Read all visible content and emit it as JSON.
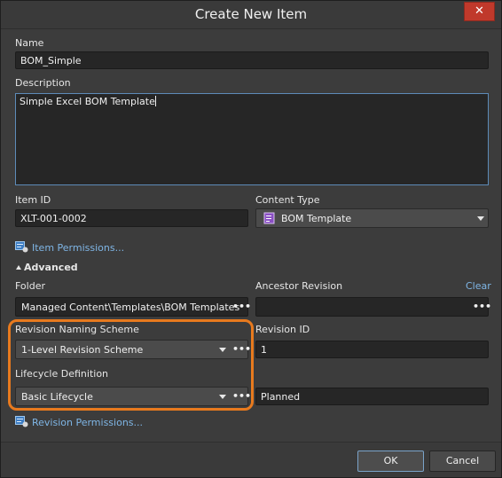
{
  "window": {
    "title": "Create New Item",
    "close_label": "✕"
  },
  "name": {
    "label": "Name",
    "value": "BOM_Simple"
  },
  "description": {
    "label": "Description",
    "value": "Simple Excel BOM Template"
  },
  "item_id": {
    "label": "Item ID",
    "value": "XLT-001-0002"
  },
  "content_type": {
    "label": "Content Type",
    "value": "BOM Template",
    "icon": "bom-template-icon"
  },
  "item_permissions": {
    "label": "Item Permissions..."
  },
  "advanced": {
    "label": "Advanced",
    "expanded": true
  },
  "folder": {
    "label": "Folder",
    "value": "Managed Content\\Templates\\BOM Templates",
    "browse": "•••"
  },
  "ancestor_revision": {
    "label": "Ancestor Revision",
    "clear_label": "Clear",
    "value": "",
    "browse": "•••"
  },
  "revision_naming_scheme": {
    "label": "Revision Naming Scheme",
    "value": "1-Level Revision Scheme",
    "browse": "•••"
  },
  "revision_id": {
    "label": "Revision ID",
    "value": "1"
  },
  "lifecycle_definition": {
    "label": "Lifecycle Definition",
    "value": "Basic Lifecycle",
    "browse": "•••",
    "state": "Planned"
  },
  "revision_permissions": {
    "label": "Revision Permissions..."
  },
  "buttons": {
    "ok": "OK",
    "cancel": "Cancel"
  },
  "colors": {
    "highlight": "#e87a1e",
    "link": "#7fb6e6",
    "close": "#c0392b"
  }
}
